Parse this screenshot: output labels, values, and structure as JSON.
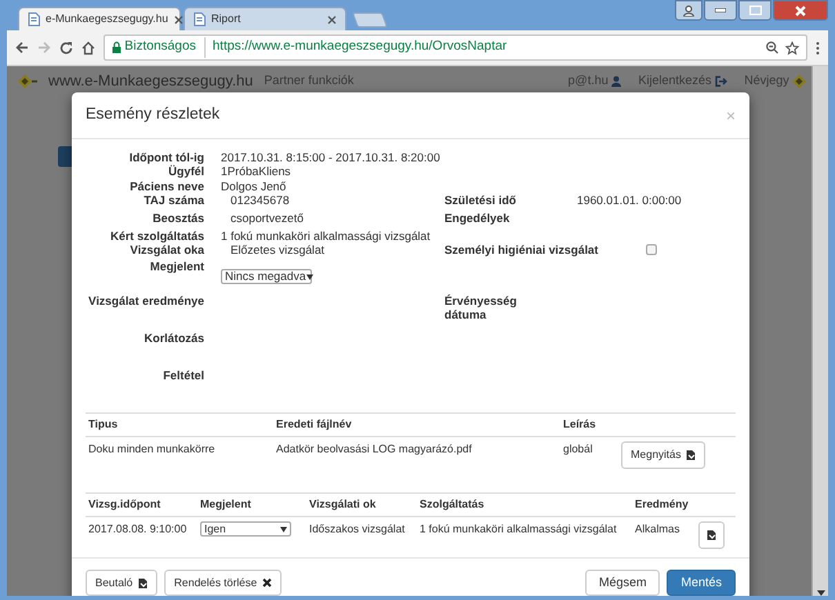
{
  "browser": {
    "tabs": [
      {
        "title": "e-Munkaegeszsegugy.hu",
        "selected": true
      },
      {
        "title": "Riport",
        "selected": false
      }
    ],
    "security_label": "Biztonságos",
    "url": "https://www.e-munkaegeszsegugy.hu/OrvosNaptar"
  },
  "page_header": {
    "site": "www.e-Munkaegeszsegugy.hu",
    "menu": "Partner funkciók",
    "user": "p@t.hu",
    "logout": "Kijelentkezés",
    "about": "Névjegy"
  },
  "modal": {
    "title": "Esemény részletek",
    "close": "×",
    "details": [
      {
        "left": {
          "label": "Időpont tól-ig",
          "value": "2017.10.31. 8:15:00 - 2017.10.31. 8:20:00"
        }
      },
      {
        "left": {
          "label": "Ügyfél",
          "value": "1PróbaKliens"
        }
      },
      {
        "left": {
          "label": "Páciens neve",
          "value": "Dolgos Jenő"
        }
      },
      {
        "left": {
          "label": "TAJ száma",
          "value": "012345678"
        },
        "right": {
          "kind": "text",
          "label": "Születési idő",
          "value": "1960.01.01. 0:00:00"
        }
      },
      {
        "left": {
          "label": "Beosztás",
          "value": "csoportvezető"
        },
        "right": {
          "kind": "text",
          "label": "Engedélyek"
        }
      },
      {
        "left": {
          "label": "Kért szolgáltatás",
          "value": "1 fokú munkaköri alkalmassági vizsgálat"
        }
      },
      {
        "left": {
          "label": "Vizsgálat oka",
          "value": "Előzetes vizsgálat"
        },
        "right": {
          "kind": "checkbox",
          "label": "Személyi higiéniai vizsgálat",
          "checked": false
        }
      },
      {
        "left": {
          "label": "Megjelent",
          "kind": "select",
          "value": "Nincs megadva"
        }
      },
      {
        "left": {
          "label": "Vizsgálat eredménye"
        },
        "right": {
          "kind": "text",
          "label": "Érvényesség dátuma"
        }
      },
      {
        "left": {
          "label": "Korlátozás"
        }
      },
      {
        "left": {
          "label": "Feltétel"
        }
      }
    ],
    "documents": {
      "columns": [
        "Tipus",
        "Eredeti fájlnév",
        "Leírás"
      ],
      "rows": [
        {
          "cells": [
            "Doku minden munkakörre",
            "Adatkör beolvasási LOG magyarázó.pdf",
            "globál"
          ],
          "button": "Megnyitás"
        }
      ]
    },
    "exams": {
      "columns": [
        "Vizsg.időpont",
        "Megjelent",
        "Vizsgálati ok",
        "Szolgáltatás",
        "Eredmény"
      ],
      "rows": [
        {
          "date": "2017.08.08. 9:10:00",
          "attended": "Igen",
          "reason": "Időszakos vizsgálat",
          "service": "1 fokú munkaköri alkalmassági vizsgálat",
          "result": "Alkalmas"
        }
      ]
    },
    "footer_buttons": [
      {
        "label": "Beutaló",
        "kind": "file"
      },
      {
        "label": "Rendelés törlése",
        "kind": "cross"
      },
      {
        "label": "Mégsem",
        "kind": "plain"
      },
      {
        "label": "Mentés",
        "kind": "primary"
      }
    ]
  }
}
